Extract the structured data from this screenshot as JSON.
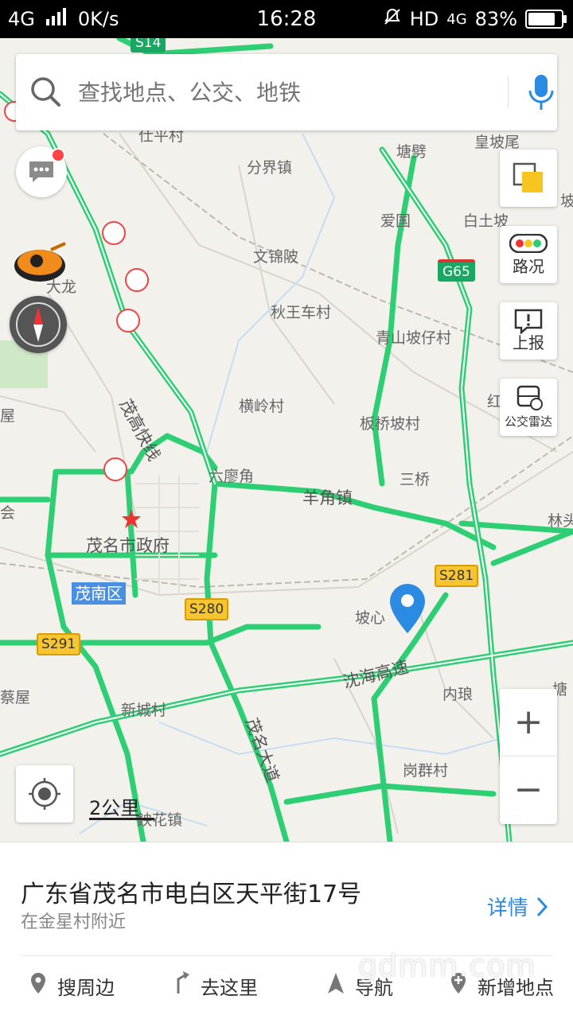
{
  "status": {
    "network": "4G",
    "speed": "0K/s",
    "time": "16:28",
    "hd": "HD",
    "net2": "4G",
    "battery": "83%",
    "battery_level": 0.83
  },
  "search": {
    "placeholder": "查找地点、公交、地铁"
  },
  "map_labels": {
    "fenjie": "分界镇",
    "wenjinling": "文锦陂",
    "qiuwangche": "秋王车村",
    "hengling": "横岭村",
    "banqiaopo": "板桥坡村",
    "qingshan": "青山坡仔村",
    "liuliao": "六廖角",
    "yangjiao": "羊角镇",
    "sanqiao": "三桥",
    "gov": "茂名市政府",
    "xincheng": "新城村",
    "gangqun": "岗群村",
    "neilang": "内琅",
    "poxin": "坡心",
    "aiguo": "爱国",
    "baitu": "白土坡",
    "huangpo": "皇坡尾",
    "tangbian": "塘劈",
    "dalong": "大龙",
    "linlou": "林头",
    "hui": "会",
    "caiwu": "蔡屋",
    "jiaohua": "鉠花镇",
    "shizicun": "仕平村",
    "hong": "红",
    "tang2": "塘",
    "po": "坡",
    "wu": "屋",
    "road_maogao": "茂高快线",
    "road_shenhai": "沈海高速",
    "road_maoming": "茂名大道"
  },
  "shields": {
    "s14": "S14",
    "g65": "G65",
    "s281": "S281",
    "s280": "S280",
    "s291": "S291"
  },
  "district": "茂南区",
  "controls": {
    "layers_label": "",
    "traffic_label": "路况",
    "report_label": "上报",
    "bus_label": "公交雷达",
    "zoom_in": "+",
    "zoom_out": "−"
  },
  "scale": "2公里",
  "place": {
    "address": "广东省茂名市电白区天平街17号",
    "nearby": "在金星村附近",
    "detail": "详情"
  },
  "actions": {
    "around": "搜周边",
    "go": "去这里",
    "navigate": "导航",
    "add": "新增地点"
  },
  "watermark": "gdmm.com",
  "colors": {
    "road": "#2ecf74",
    "accent": "#2b8ae2",
    "pin": "#2b8ae2"
  }
}
